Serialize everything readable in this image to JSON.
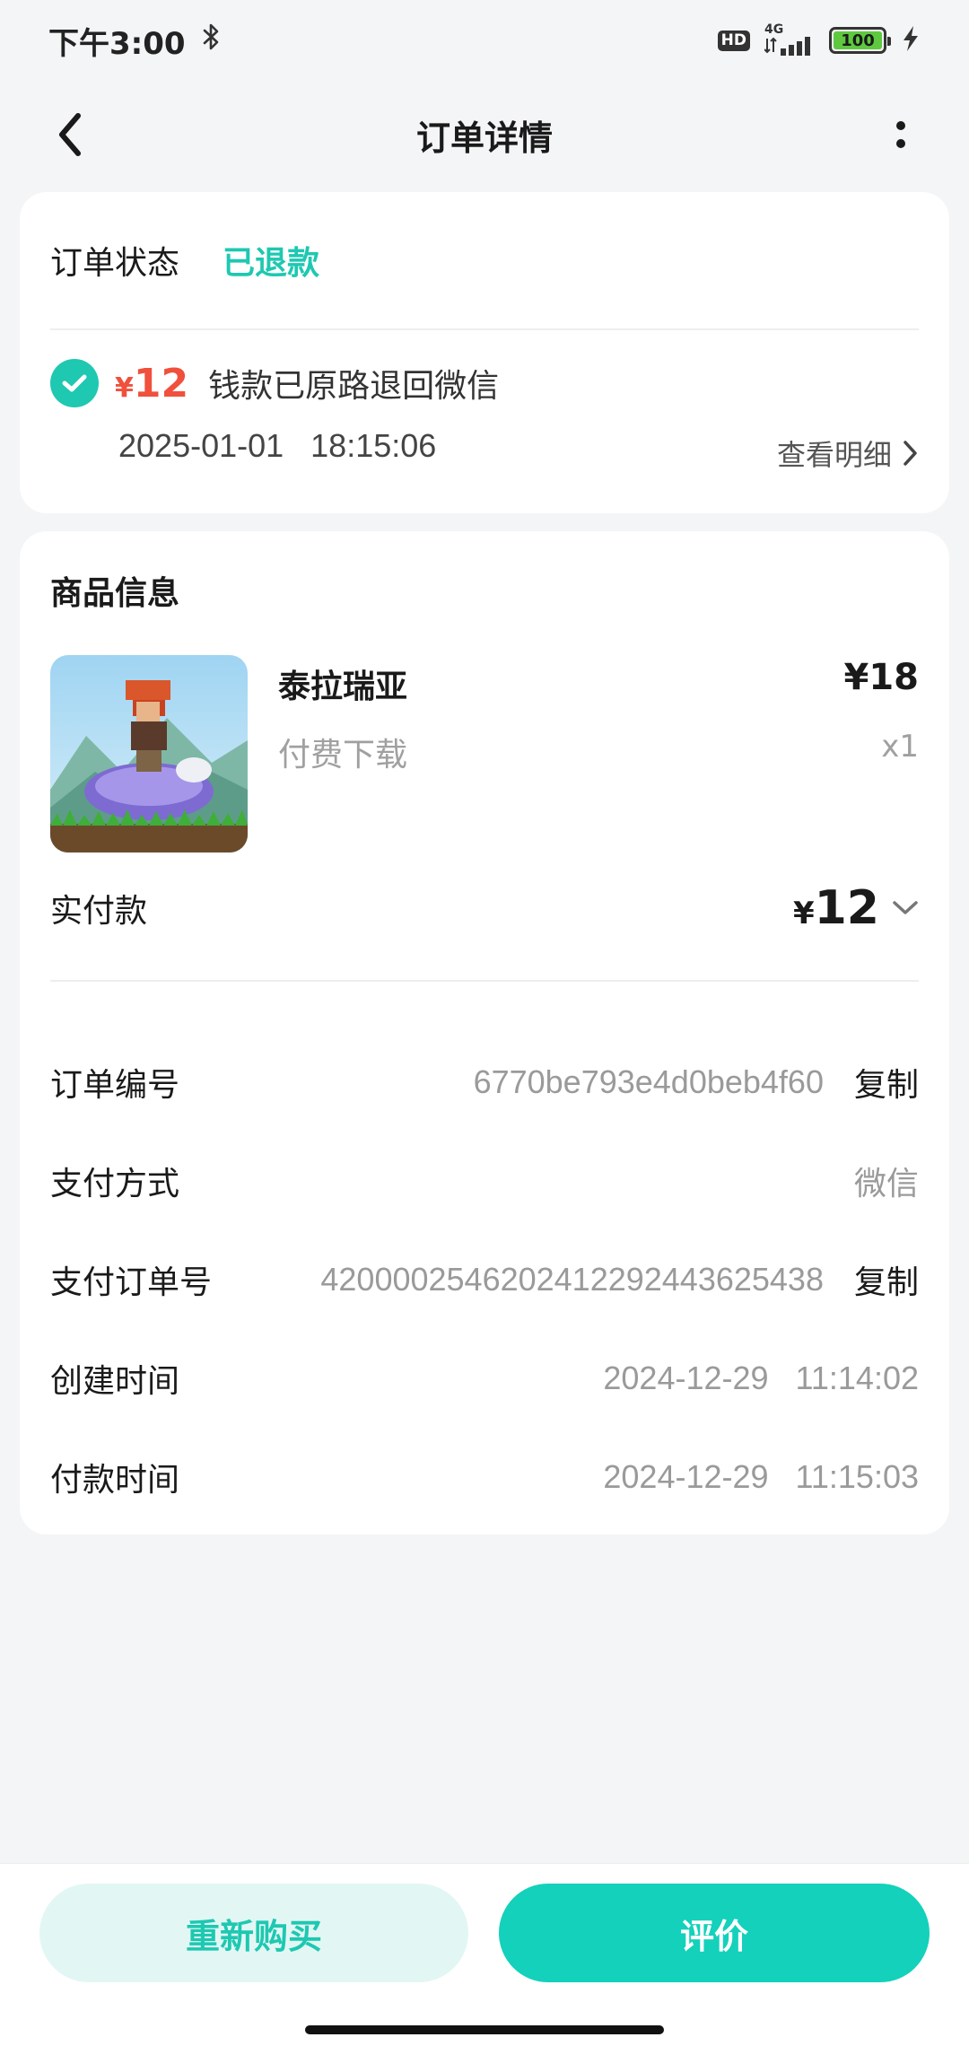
{
  "status_bar": {
    "time": "下午3:00",
    "hd": "HD",
    "network": "4G",
    "battery": "100"
  },
  "nav": {
    "title": "订单详情"
  },
  "order_status": {
    "label": "订单状态",
    "value": "已退款",
    "refund_currency": "¥",
    "refund_amount": "12",
    "refund_text": "钱款已原路退回微信",
    "refund_time": "2025-01-01   18:15:06",
    "detail_link": "查看明细"
  },
  "goods": {
    "section_title": "商品信息",
    "name": "泰拉瑞亚",
    "type": "付费下载",
    "price": "¥18",
    "quantity": "x1",
    "paid_label": "实付款",
    "paid_currency": "¥",
    "paid_amount": "12"
  },
  "info": {
    "order_no_label": "订单编号",
    "order_no": "6770be793e4d0beb4f60",
    "order_no_copy": "复制",
    "pay_method_label": "支付方式",
    "pay_method": "微信",
    "pay_order_no_label": "支付订单号",
    "pay_order_no": "4200002546202412292443625438",
    "pay_order_no_copy": "复制",
    "created_label": "创建时间",
    "created_time": "2024-12-29   11:14:02",
    "paid_label": "付款时间",
    "paid_time": "2024-12-29   11:15:03"
  },
  "actions": {
    "rebuy": "重新购买",
    "review": "评价"
  },
  "colors": {
    "accent": "#1ec8b1",
    "refund_red": "#f0503c",
    "review_button": "#13d1bb",
    "rebuy_button_bg": "#e2f7f4"
  }
}
